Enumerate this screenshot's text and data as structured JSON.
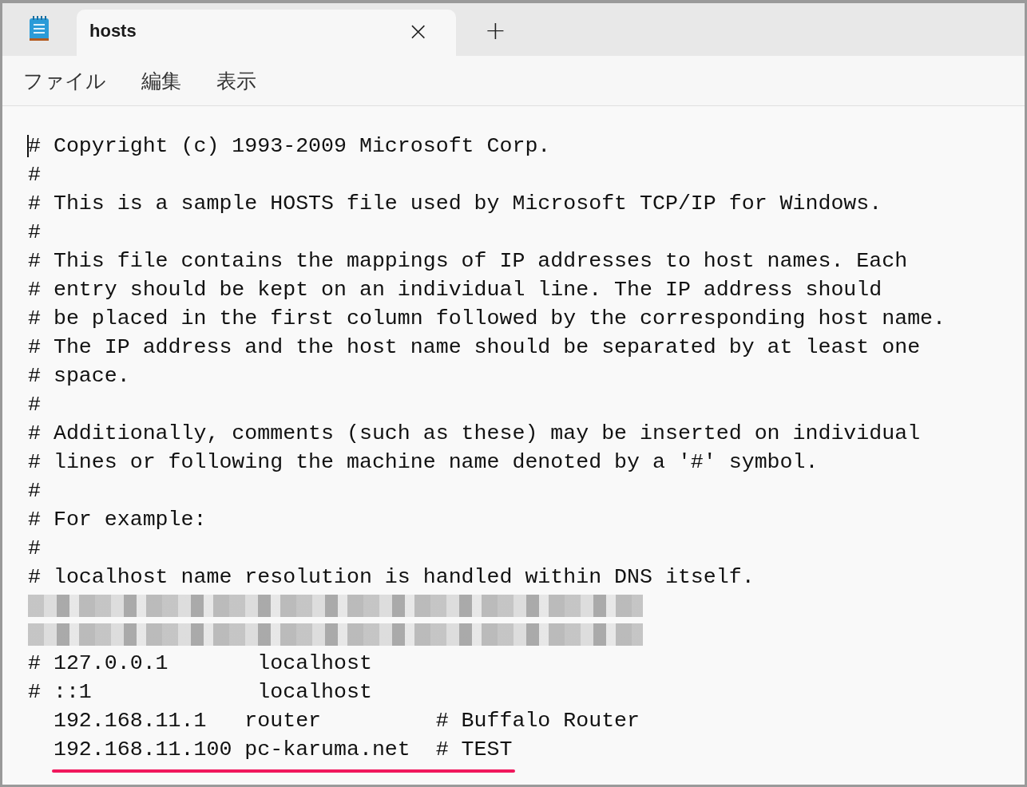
{
  "tabs": [
    {
      "label": "hosts",
      "selected": true
    }
  ],
  "tab_bar": {
    "close_glyph": "×",
    "new_tab_glyph": "+"
  },
  "menu": [
    "ファイル",
    "編集",
    "表示"
  ],
  "editor": {
    "lines": [
      {
        "kind": "text",
        "text": "# Copyright (c) 1993-2009 Microsoft Corp.",
        "underlined": false,
        "caret": true
      },
      {
        "kind": "text",
        "text": "#",
        "underlined": false
      },
      {
        "kind": "text",
        "text": "# This is a sample HOSTS file used by Microsoft TCP/IP for Windows.",
        "underlined": false
      },
      {
        "kind": "text",
        "text": "#",
        "underlined": false
      },
      {
        "kind": "text",
        "text": "# This file contains the mappings of IP addresses to host names. Each",
        "underlined": false
      },
      {
        "kind": "text",
        "text": "# entry should be kept on an individual line. The IP address should",
        "underlined": false
      },
      {
        "kind": "text",
        "text": "# be placed in the first column followed by the corresponding host name.",
        "underlined": false
      },
      {
        "kind": "text",
        "text": "# The IP address and the host name should be separated by at least one",
        "underlined": false
      },
      {
        "kind": "text",
        "text": "# space.",
        "underlined": false
      },
      {
        "kind": "text",
        "text": "#",
        "underlined": false
      },
      {
        "kind": "text",
        "text": "# Additionally, comments (such as these) may be inserted on individual",
        "underlined": false
      },
      {
        "kind": "text",
        "text": "# lines or following the machine name denoted by a '#' symbol.",
        "underlined": false
      },
      {
        "kind": "text",
        "text": "#",
        "underlined": false
      },
      {
        "kind": "text",
        "text": "# For example:",
        "underlined": false
      },
      {
        "kind": "text",
        "text": "#",
        "underlined": false
      },
      {
        "kind": "text",
        "text": "# localhost name resolution is handled within DNS itself.",
        "underlined": false
      },
      {
        "kind": "redacted",
        "underlined": false
      },
      {
        "kind": "redacted",
        "underlined": false
      },
      {
        "kind": "text",
        "text": "# 127.0.0.1       localhost",
        "underlined": false
      },
      {
        "kind": "text",
        "text": "# ::1             localhost",
        "underlined": false
      },
      {
        "kind": "text",
        "text": "  192.168.11.1   router         # Buffalo Router",
        "underlined": false
      },
      {
        "kind": "text",
        "text": "  192.168.11.100 pc-karuma.net  # TEST",
        "underlined": true
      }
    ]
  }
}
